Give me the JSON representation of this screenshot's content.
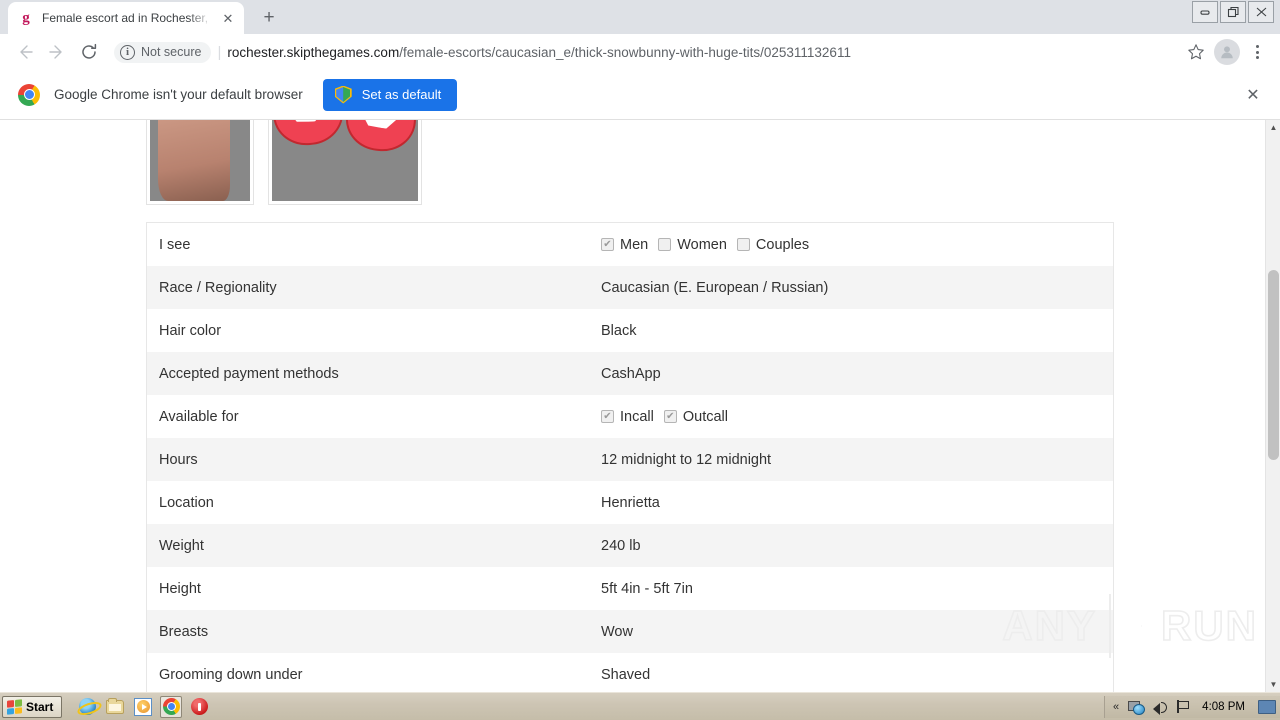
{
  "browser": {
    "tab": {
      "favicon": "g-favicon",
      "title": "Female escort ad in Rochester, New",
      "close_label": "✕"
    },
    "newtab_label": "+",
    "window_controls": {
      "minimize": "—",
      "maximize": "❐",
      "close": "✕"
    },
    "nav": {
      "back": "←",
      "forward": "→",
      "reload": "⟳"
    },
    "omnibox": {
      "security_icon": "info-circle-icon",
      "security_glyph": "i",
      "security_text": "Not secure",
      "separator": "|",
      "url_host": "rochester.skipthegames.com",
      "url_path": "/female-escorts/caucasian_e/thick-snowbunny-with-huge-tits/025311132611"
    },
    "toolbar_right": {
      "bookmark_star": "☆",
      "profile_avatar": "avatar-icon",
      "menu": "⋮"
    },
    "infobar": {
      "logo": "chrome-logo-icon",
      "message": "Google Chrome isn't your default browser",
      "button_label": "Set as default",
      "button_icon": "shield-icon",
      "close_label": "✕",
      "button_color": "#1a73e8"
    }
  },
  "page": {
    "thumbnails": [
      {
        "name": "photo-thumbnail-1",
        "alt": "escort-photo-legs"
      },
      {
        "name": "photo-thumbnail-2",
        "alt": "escort-photo-lips-censored"
      }
    ],
    "details_table": {
      "rows": [
        {
          "label": "I see",
          "type": "checkboxes",
          "options": [
            {
              "text": "Men",
              "checked": true
            },
            {
              "text": "Women",
              "checked": false
            },
            {
              "text": "Couples",
              "checked": false
            }
          ]
        },
        {
          "label": "Race / Regionality",
          "type": "text",
          "value": "Caucasian (E. European / Russian)"
        },
        {
          "label": "Hair color",
          "type": "text",
          "value": "Black"
        },
        {
          "label": "Accepted payment methods",
          "type": "text",
          "value": "CashApp"
        },
        {
          "label": "Available for",
          "type": "checkboxes",
          "options": [
            {
              "text": "Incall",
              "checked": true
            },
            {
              "text": "Outcall",
              "checked": true
            }
          ]
        },
        {
          "label": "Hours",
          "type": "text",
          "value": "12 midnight to 12 midnight"
        },
        {
          "label": "Location",
          "type": "text",
          "value": "Henrietta"
        },
        {
          "label": "Weight",
          "type": "text",
          "value": "240 lb"
        },
        {
          "label": "Height",
          "type": "text",
          "value": "5ft 4in - 5ft 7in"
        },
        {
          "label": "Breasts",
          "type": "text",
          "value": "Wow"
        },
        {
          "label": "Grooming down under",
          "type": "text",
          "value": "Shaved"
        }
      ]
    },
    "watermark": {
      "left_text": "ANY",
      "right_text": "RUN",
      "icon": "play-triangle-icon"
    },
    "scrollbar": {
      "up_arrow": "▲",
      "down_arrow": "▼"
    }
  },
  "taskbar": {
    "start_label": "Start",
    "quick_launch": [
      {
        "name": "internet-explorer-icon"
      },
      {
        "name": "folder-icon"
      },
      {
        "name": "media-player-icon"
      },
      {
        "name": "chrome-icon",
        "active": true
      },
      {
        "name": "record-stop-icon"
      }
    ],
    "tray": {
      "expand_label": "«",
      "items": [
        "network-icon",
        "volume-icon",
        "flag-icon"
      ],
      "time": "4:08 PM",
      "show_desktop": "show-desktop-icon"
    }
  }
}
